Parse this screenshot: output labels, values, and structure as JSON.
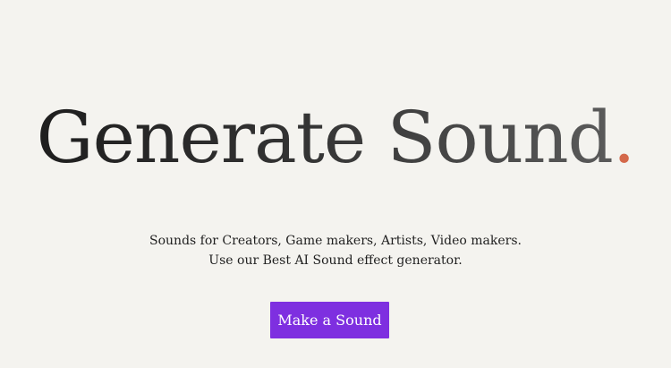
{
  "hero": {
    "headline": "Generate Sound",
    "headline_dot": ".",
    "subtitle_line1": "Sounds for Creators, Game makers, Artists, Video makers.",
    "subtitle_line2": "Use our Best AI Sound effect generator.",
    "cta_label": "Make a Sound"
  },
  "colors": {
    "background": "#f4f3ef",
    "accent_dot": "#d4684a",
    "cta_background": "#7e2fe0",
    "cta_text": "#ffffff",
    "body_text": "#1f1f1f"
  }
}
